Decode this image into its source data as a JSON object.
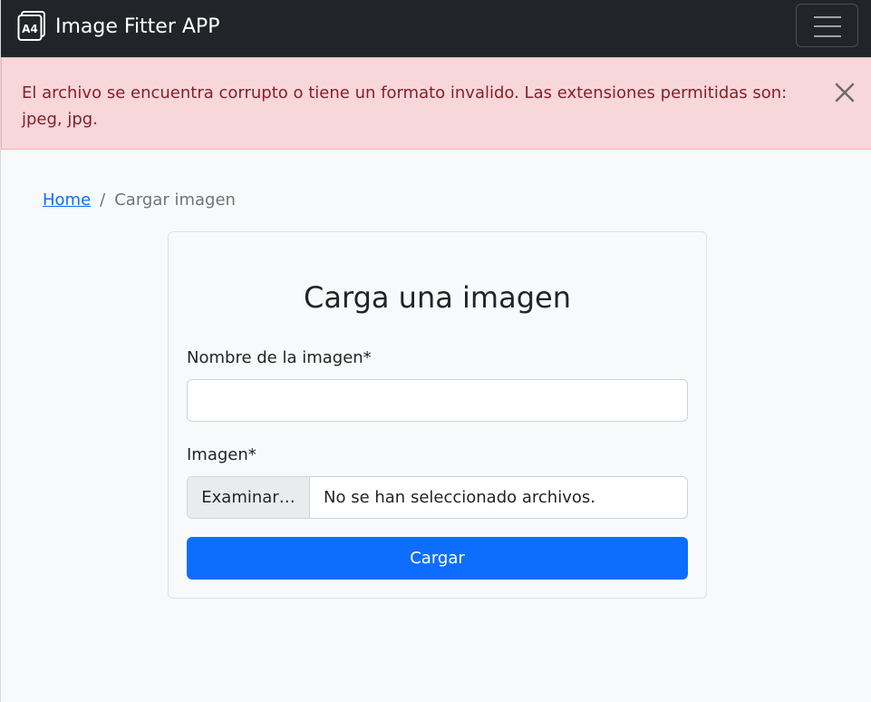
{
  "navbar": {
    "brand_icon_text": "A4",
    "brand_title": "Image Fitter APP",
    "menu_icon": "hamburger-icon"
  },
  "alert": {
    "message": "El archivo se encuentra corrupto o tiene un formato invalido. Las extensiones permitidas son: jpeg, jpg.",
    "close_icon": "close-icon"
  },
  "breadcrumb": {
    "home": "Home",
    "separator": "/",
    "current": "Cargar imagen"
  },
  "form": {
    "title": "Carga una imagen",
    "name_label": "Nombre de la imagen*",
    "name_value": "",
    "image_label": "Imagen*",
    "file_button": "Examinar…",
    "file_status": "No se han seleccionado archivos.",
    "submit_label": "Cargar"
  },
  "colors": {
    "navbar": "#212529",
    "alert_bg": "#f8d7da",
    "alert_text": "#842029",
    "primary": "#0d6efd"
  }
}
